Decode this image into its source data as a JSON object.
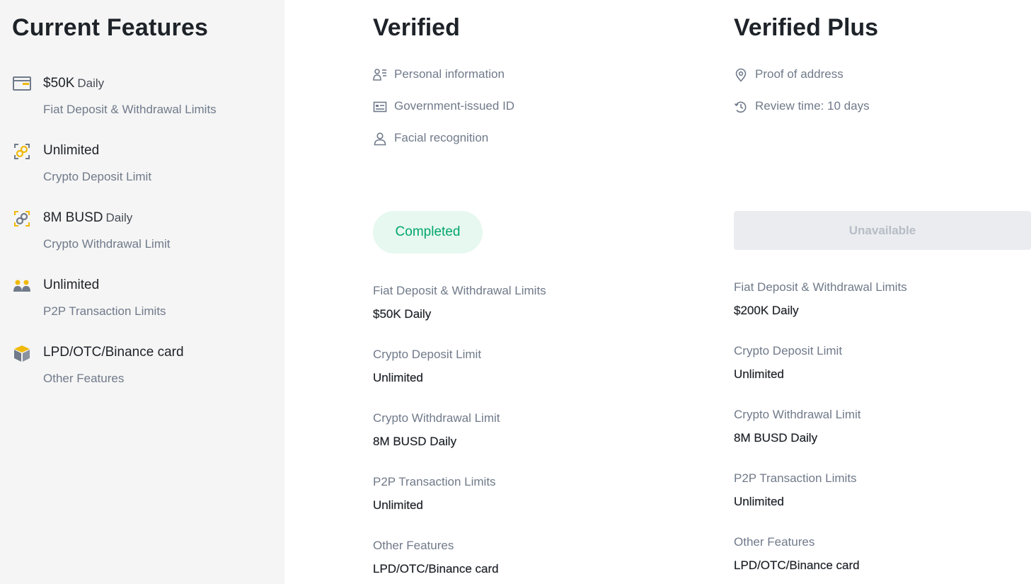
{
  "current": {
    "title": "Current Features",
    "features": [
      {
        "value": "$50K",
        "suffix": "Daily",
        "sub": "Fiat Deposit & Withdrawal Limits",
        "icon": "card-icon"
      },
      {
        "value": "Unlimited",
        "suffix": "",
        "sub": "Crypto Deposit Limit",
        "icon": "crypto-deposit-icon"
      },
      {
        "value": "8M BUSD",
        "suffix": "Daily",
        "sub": "Crypto Withdrawal Limit",
        "icon": "crypto-withdrawal-icon"
      },
      {
        "value": "Unlimited",
        "suffix": "",
        "sub": "P2P Transaction Limits",
        "icon": "users-icon"
      },
      {
        "value": "LPD/OTC/Binance card",
        "suffix": "",
        "sub": "Other Features",
        "icon": "box-icon"
      }
    ]
  },
  "verified": {
    "title": "Verified",
    "requirements": [
      {
        "label": "Personal information",
        "icon": "person-list-icon"
      },
      {
        "label": "Government-issued ID",
        "icon": "id-card-icon"
      },
      {
        "label": "Facial recognition",
        "icon": "person-icon"
      }
    ],
    "status": "Completed",
    "limits": [
      {
        "label": "Fiat Deposit & Withdrawal Limits",
        "value": "$50K Daily"
      },
      {
        "label": "Crypto Deposit Limit",
        "value": "Unlimited"
      },
      {
        "label": "Crypto Withdrawal Limit",
        "value": "8M BUSD Daily"
      },
      {
        "label": "P2P Transaction Limits",
        "value": "Unlimited"
      },
      {
        "label": "Other Features",
        "value": "LPD/OTC/Binance card"
      }
    ]
  },
  "verified_plus": {
    "title": "Verified Plus",
    "requirements": [
      {
        "label": "Proof of address",
        "icon": "location-pin-icon"
      },
      {
        "label": "Review time: 10 days",
        "icon": "clock-history-icon"
      }
    ],
    "status": "Unavailable",
    "limits": [
      {
        "label": "Fiat Deposit & Withdrawal Limits",
        "value": "$200K Daily"
      },
      {
        "label": "Crypto Deposit Limit",
        "value": "Unlimited"
      },
      {
        "label": "Crypto Withdrawal Limit",
        "value": "8M BUSD Daily"
      },
      {
        "label": "P2P Transaction Limits",
        "value": "Unlimited"
      },
      {
        "label": "Other Features",
        "value": "LPD/OTC/Binance card"
      }
    ]
  },
  "colors": {
    "accent_yellow": "#f0b90b",
    "success_green": "#03a66d",
    "muted_gray": "#707a8a"
  }
}
